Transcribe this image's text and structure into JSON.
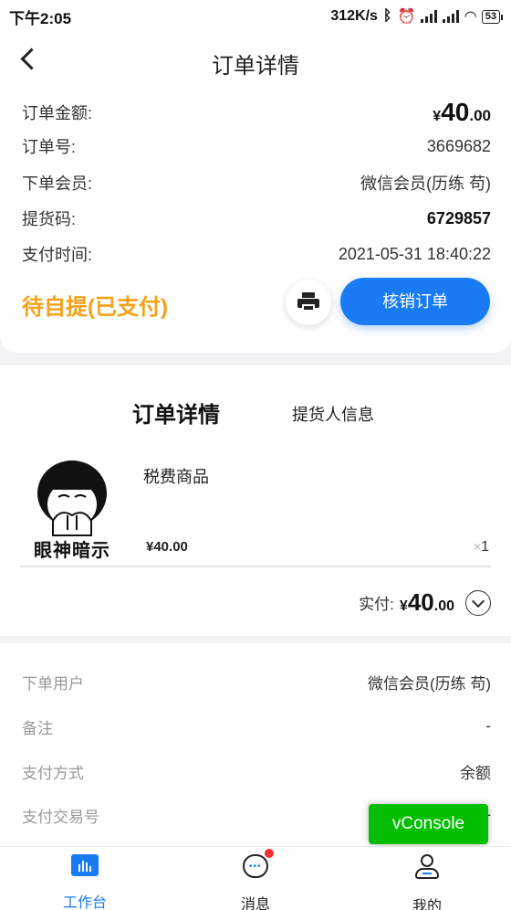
{
  "status_bar": {
    "time": "下午2:05",
    "speed": "312K/s",
    "battery": "53"
  },
  "header": {
    "title": "订单详情"
  },
  "order": {
    "amount_label": "订单金额:",
    "amount_currency": "¥",
    "amount_int": "40",
    "amount_dec": ".00",
    "number_label": "订单号:",
    "number": "3669682",
    "member_label": "下单会员:",
    "member": "微信会员(历练 苟)",
    "pickup_label": "提货码:",
    "pickup_code": "6729857",
    "time_label": "支付时间:",
    "time": "2021-05-31 18:40:22",
    "status": "待自提(已支付)",
    "verify_button": "核销订单"
  },
  "tabs": [
    {
      "label": "订单详情"
    },
    {
      "label": "提货人信息"
    }
  ],
  "product": {
    "image_caption": "眼神暗示",
    "name": "税费商品",
    "price": "¥40.00",
    "qty_x": "×",
    "qty": "1"
  },
  "paid": {
    "label": "实付:",
    "currency": "¥",
    "amount_int": "40",
    "amount_dec": ".00"
  },
  "user_info": {
    "rows": [
      {
        "key": "下单用户",
        "value": "微信会员(历练 苟)"
      },
      {
        "key": "备注",
        "value": "-"
      },
      {
        "key": "支付方式",
        "value": "余额"
      },
      {
        "key": "支付交易号",
        "value": "-"
      }
    ]
  },
  "vconsole": "vConsole",
  "nav": {
    "items": [
      {
        "label": "工作台"
      },
      {
        "label": "消息"
      },
      {
        "label": "我的"
      }
    ]
  },
  "colors": {
    "primary": "#1a7cf5",
    "status_orange": "#f5a21a",
    "vconsole_green": "#04be02",
    "badge_red": "#f23030"
  }
}
